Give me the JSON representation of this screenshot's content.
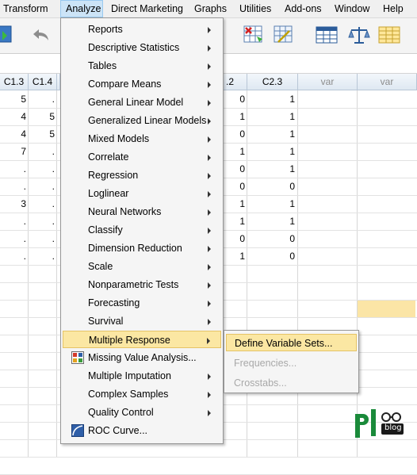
{
  "menubar": {
    "items": [
      {
        "label": "Transform"
      },
      {
        "label": "Analyze"
      },
      {
        "label": "Direct Marketing"
      },
      {
        "label": "Graphs"
      },
      {
        "label": "Utilities"
      },
      {
        "label": "Add-ons"
      },
      {
        "label": "Window"
      },
      {
        "label": "Help"
      }
    ],
    "active": "Analyze"
  },
  "grid": {
    "columns": [
      "C1.3",
      "C1.4",
      ".2",
      "C2.3",
      "var",
      "var"
    ],
    "left_values": [
      [
        "5",
        "."
      ],
      [
        "4",
        "5"
      ],
      [
        "4",
        "5"
      ],
      [
        "7",
        "."
      ],
      [
        ".",
        "."
      ],
      [
        ".",
        "."
      ],
      [
        "3",
        "."
      ],
      [
        ".",
        "."
      ],
      [
        ".",
        "."
      ],
      [
        ".",
        "."
      ]
    ],
    "right_values": [
      [
        "0",
        "1"
      ],
      [
        "1",
        "1"
      ],
      [
        "0",
        "1"
      ],
      [
        "1",
        "1"
      ],
      [
        "0",
        "1"
      ],
      [
        "0",
        "0"
      ],
      [
        "1",
        "1"
      ],
      [
        "1",
        "1"
      ],
      [
        "0",
        "0"
      ],
      [
        "1",
        "0"
      ]
    ]
  },
  "analyze_menu": {
    "items": [
      {
        "label": "Reports",
        "submenu": true
      },
      {
        "label": "Descriptive Statistics",
        "submenu": true
      },
      {
        "label": "Tables",
        "submenu": true
      },
      {
        "label": "Compare Means",
        "submenu": true
      },
      {
        "label": "General Linear Model",
        "submenu": true
      },
      {
        "label": "Generalized Linear Models",
        "submenu": true
      },
      {
        "label": "Mixed Models",
        "submenu": true
      },
      {
        "label": "Correlate",
        "submenu": true
      },
      {
        "label": "Regression",
        "submenu": true
      },
      {
        "label": "Loglinear",
        "submenu": true
      },
      {
        "label": "Neural Networks",
        "submenu": true
      },
      {
        "label": "Classify",
        "submenu": true
      },
      {
        "label": "Dimension Reduction",
        "submenu": true
      },
      {
        "label": "Scale",
        "submenu": true
      },
      {
        "label": "Nonparametric Tests",
        "submenu": true
      },
      {
        "label": "Forecasting",
        "submenu": true
      },
      {
        "label": "Survival",
        "submenu": true
      },
      {
        "label": "Multiple Response",
        "submenu": true,
        "selected": true
      },
      {
        "label": "Missing Value Analysis...",
        "submenu": false,
        "icon": "missing-value-icon"
      },
      {
        "label": "Multiple Imputation",
        "submenu": true
      },
      {
        "label": "Complex Samples",
        "submenu": true
      },
      {
        "label": "Quality Control",
        "submenu": true
      },
      {
        "label": "ROC Curve...",
        "submenu": false,
        "icon": "roc-curve-icon"
      }
    ]
  },
  "multiple_response_submenu": {
    "items": [
      {
        "label": "Define Variable Sets...",
        "enabled": true,
        "selected": true
      },
      {
        "label": "Frequencies...",
        "enabled": false
      },
      {
        "label": "Crosstabs...",
        "enabled": false
      }
    ]
  },
  "toolbar": {
    "icons": [
      "import-data-icon",
      "undo-icon",
      "select-cases-icon",
      "value-labels-icon",
      "insert-cases-icon",
      "weight-cases-icon",
      "split-file-icon"
    ]
  },
  "logo": {
    "text": "blog"
  },
  "colors": {
    "highlight": "#fbe7a3",
    "menu_bg": "#f5f5f5",
    "header_bg": "#dfe8f2",
    "active_menu": "#cce4f7"
  }
}
